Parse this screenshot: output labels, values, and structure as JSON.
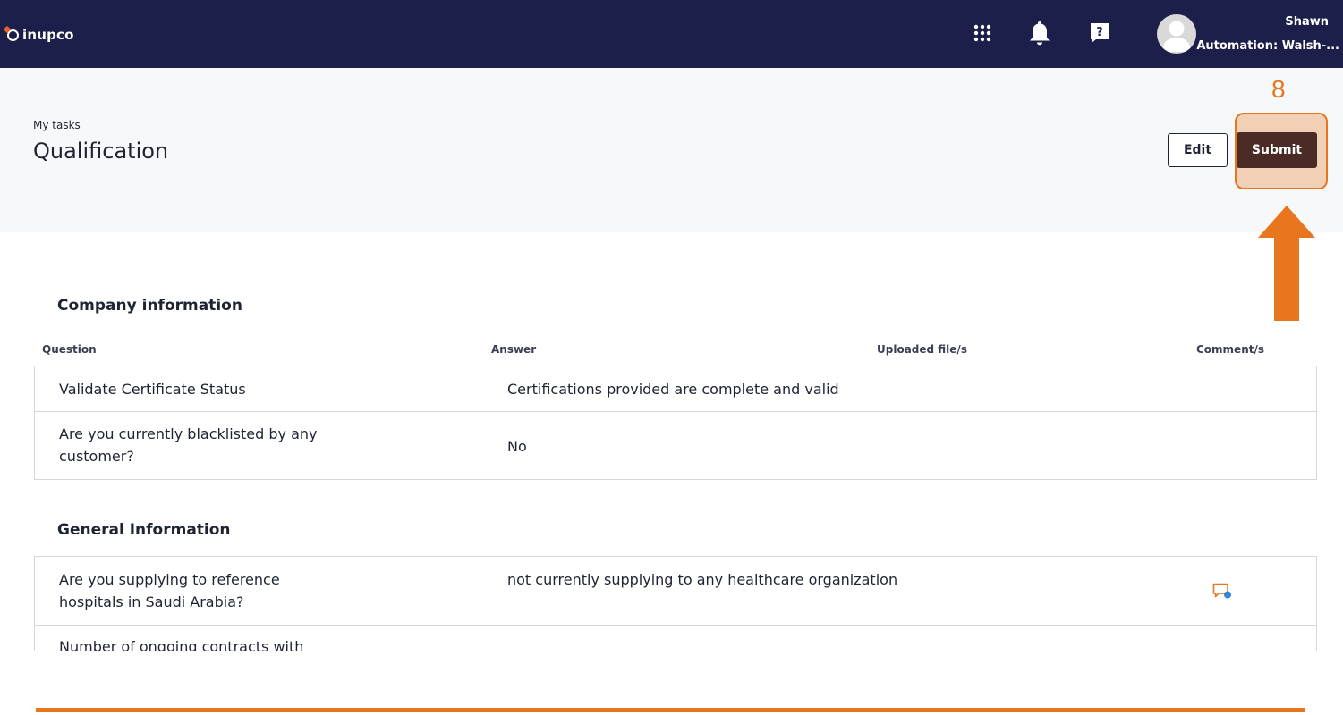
{
  "app": {
    "brand": "inupco",
    "brand_accent": "#e8612c",
    "topbar_color": "#1b1f4a"
  },
  "topbar": {
    "icons": [
      "apps-grid-icon",
      "bell-icon",
      "help-icon"
    ],
    "user": {
      "name": "Shawn",
      "org": "Automation: Walsh-..."
    }
  },
  "header": {
    "breadcrumb": "My tasks",
    "title": "Qualification",
    "edit_label": "Edit",
    "submit_label": "Submit"
  },
  "annotation": {
    "step_number": "8",
    "color": "#e8761f"
  },
  "columns": [
    "Question",
    "Answer",
    "Uploaded file/s",
    "Comment/s"
  ],
  "sections": [
    {
      "title": "Company information",
      "rows": [
        {
          "question": "Validate Certificate Status",
          "answer": "Certifications provided are complete and valid"
        },
        {
          "question": "Are you currently blacklisted by any customer?",
          "answer": "No"
        }
      ]
    },
    {
      "title": "General Information",
      "rows": [
        {
          "question": "Are you supplying to reference hospitals in Saudi Arabia?",
          "answer": "not currently supplying to any healthcare organization",
          "has_comment": true
        },
        {
          "question": "Number of ongoing contracts with",
          "answer": ""
        }
      ]
    }
  ]
}
